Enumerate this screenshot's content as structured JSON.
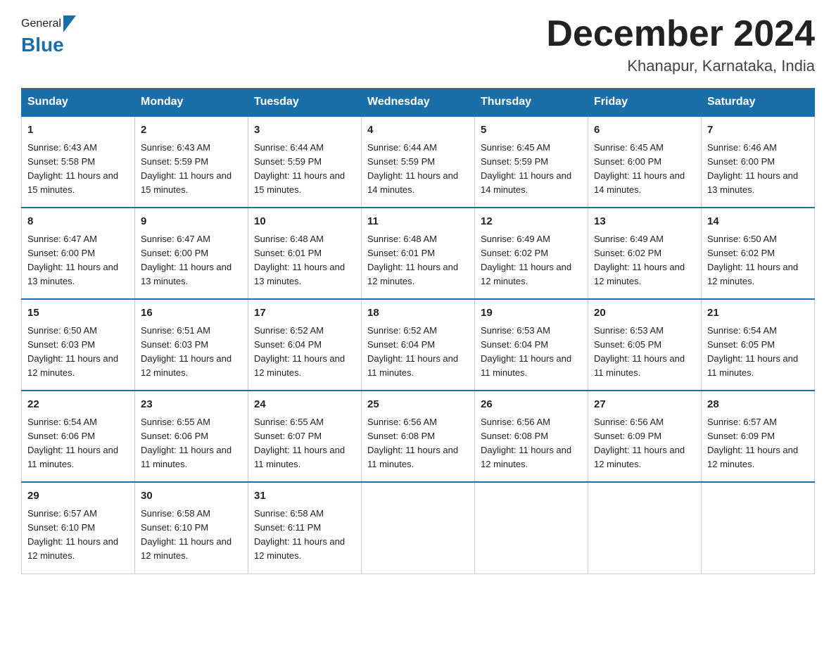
{
  "header": {
    "logo_general": "General",
    "logo_blue": "Blue",
    "month_title": "December 2024",
    "location": "Khanapur, Karnataka, India"
  },
  "weekdays": [
    "Sunday",
    "Monday",
    "Tuesday",
    "Wednesday",
    "Thursday",
    "Friday",
    "Saturday"
  ],
  "weeks": [
    [
      {
        "day": "1",
        "sunrise": "6:43 AM",
        "sunset": "5:58 PM",
        "daylight": "11 hours and 15 minutes."
      },
      {
        "day": "2",
        "sunrise": "6:43 AM",
        "sunset": "5:59 PM",
        "daylight": "11 hours and 15 minutes."
      },
      {
        "day": "3",
        "sunrise": "6:44 AM",
        "sunset": "5:59 PM",
        "daylight": "11 hours and 15 minutes."
      },
      {
        "day": "4",
        "sunrise": "6:44 AM",
        "sunset": "5:59 PM",
        "daylight": "11 hours and 14 minutes."
      },
      {
        "day": "5",
        "sunrise": "6:45 AM",
        "sunset": "5:59 PM",
        "daylight": "11 hours and 14 minutes."
      },
      {
        "day": "6",
        "sunrise": "6:45 AM",
        "sunset": "6:00 PM",
        "daylight": "11 hours and 14 minutes."
      },
      {
        "day": "7",
        "sunrise": "6:46 AM",
        "sunset": "6:00 PM",
        "daylight": "11 hours and 13 minutes."
      }
    ],
    [
      {
        "day": "8",
        "sunrise": "6:47 AM",
        "sunset": "6:00 PM",
        "daylight": "11 hours and 13 minutes."
      },
      {
        "day": "9",
        "sunrise": "6:47 AM",
        "sunset": "6:00 PM",
        "daylight": "11 hours and 13 minutes."
      },
      {
        "day": "10",
        "sunrise": "6:48 AM",
        "sunset": "6:01 PM",
        "daylight": "11 hours and 13 minutes."
      },
      {
        "day": "11",
        "sunrise": "6:48 AM",
        "sunset": "6:01 PM",
        "daylight": "11 hours and 12 minutes."
      },
      {
        "day": "12",
        "sunrise": "6:49 AM",
        "sunset": "6:02 PM",
        "daylight": "11 hours and 12 minutes."
      },
      {
        "day": "13",
        "sunrise": "6:49 AM",
        "sunset": "6:02 PM",
        "daylight": "11 hours and 12 minutes."
      },
      {
        "day": "14",
        "sunrise": "6:50 AM",
        "sunset": "6:02 PM",
        "daylight": "11 hours and 12 minutes."
      }
    ],
    [
      {
        "day": "15",
        "sunrise": "6:50 AM",
        "sunset": "6:03 PM",
        "daylight": "11 hours and 12 minutes."
      },
      {
        "day": "16",
        "sunrise": "6:51 AM",
        "sunset": "6:03 PM",
        "daylight": "11 hours and 12 minutes."
      },
      {
        "day": "17",
        "sunrise": "6:52 AM",
        "sunset": "6:04 PM",
        "daylight": "11 hours and 12 minutes."
      },
      {
        "day": "18",
        "sunrise": "6:52 AM",
        "sunset": "6:04 PM",
        "daylight": "11 hours and 11 minutes."
      },
      {
        "day": "19",
        "sunrise": "6:53 AM",
        "sunset": "6:04 PM",
        "daylight": "11 hours and 11 minutes."
      },
      {
        "day": "20",
        "sunrise": "6:53 AM",
        "sunset": "6:05 PM",
        "daylight": "11 hours and 11 minutes."
      },
      {
        "day": "21",
        "sunrise": "6:54 AM",
        "sunset": "6:05 PM",
        "daylight": "11 hours and 11 minutes."
      }
    ],
    [
      {
        "day": "22",
        "sunrise": "6:54 AM",
        "sunset": "6:06 PM",
        "daylight": "11 hours and 11 minutes."
      },
      {
        "day": "23",
        "sunrise": "6:55 AM",
        "sunset": "6:06 PM",
        "daylight": "11 hours and 11 minutes."
      },
      {
        "day": "24",
        "sunrise": "6:55 AM",
        "sunset": "6:07 PM",
        "daylight": "11 hours and 11 minutes."
      },
      {
        "day": "25",
        "sunrise": "6:56 AM",
        "sunset": "6:08 PM",
        "daylight": "11 hours and 11 minutes."
      },
      {
        "day": "26",
        "sunrise": "6:56 AM",
        "sunset": "6:08 PM",
        "daylight": "11 hours and 12 minutes."
      },
      {
        "day": "27",
        "sunrise": "6:56 AM",
        "sunset": "6:09 PM",
        "daylight": "11 hours and 12 minutes."
      },
      {
        "day": "28",
        "sunrise": "6:57 AM",
        "sunset": "6:09 PM",
        "daylight": "11 hours and 12 minutes."
      }
    ],
    [
      {
        "day": "29",
        "sunrise": "6:57 AM",
        "sunset": "6:10 PM",
        "daylight": "11 hours and 12 minutes."
      },
      {
        "day": "30",
        "sunrise": "6:58 AM",
        "sunset": "6:10 PM",
        "daylight": "11 hours and 12 minutes."
      },
      {
        "day": "31",
        "sunrise": "6:58 AM",
        "sunset": "6:11 PM",
        "daylight": "11 hours and 12 minutes."
      },
      null,
      null,
      null,
      null
    ]
  ]
}
